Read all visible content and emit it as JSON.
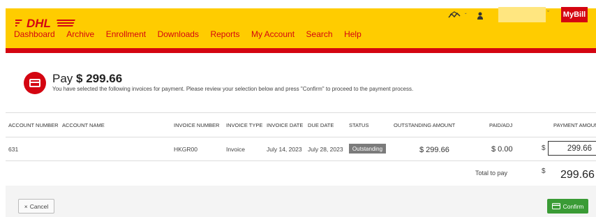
{
  "header": {
    "logo_text": "DHL",
    "mybill_label": "MyBill",
    "nav": [
      "Dashboard",
      "Archive",
      "Enrollment",
      "Downloads",
      "Reports",
      "My Account",
      "Search",
      "Help"
    ]
  },
  "pay": {
    "title_prefix": "Pay",
    "title_amount": "$ 299.66",
    "description": "You have selected the following invoices for payment. Please review your selection below and press \"Confirm\" to proceed to the payment process."
  },
  "table": {
    "headers": [
      "ACCOUNT NUMBER",
      "ACCOUNT NAME",
      "INVOICE NUMBER",
      "INVOICE TYPE",
      "INVOICE DATE",
      "DUE DATE",
      "STATUS",
      "OUTSTANDING AMOUNT",
      "PAID/ADJ",
      "PAYMENT AMOUNT"
    ],
    "rows": [
      {
        "account_number": "631",
        "account_name": "",
        "invoice_number": "HKGR00",
        "invoice_type": "Invoice",
        "invoice_date": "July 14, 2023",
        "due_date": "July 28, 2023",
        "status": "Outstanding",
        "outstanding_amount": "$ 299.66",
        "paid_adj": "$ 0.00",
        "payment_currency": "$",
        "payment_amount": "299.66"
      }
    ],
    "total_label": "Total to pay",
    "total_currency": "$",
    "total_value": "299.66"
  },
  "footer": {
    "cancel_label": "Cancel",
    "confirm_label": "Confirm"
  },
  "colors": {
    "brand_yellow": "#ffcc00",
    "brand_red": "#d40511",
    "confirm_green": "#3a9b35",
    "status_gray": "#7b7b7b"
  }
}
